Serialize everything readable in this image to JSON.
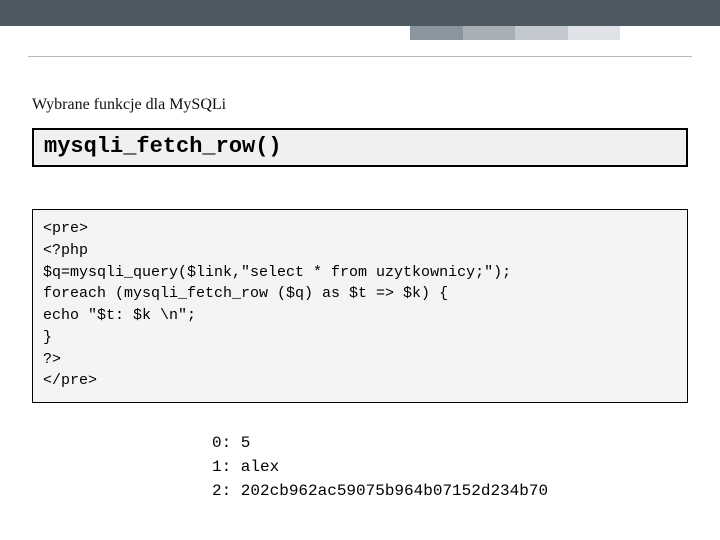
{
  "header": {
    "subtitle": "Wybrane funkcje dla MySQLi"
  },
  "function_box": {
    "name": "mysqli_fetch_row()"
  },
  "code": {
    "lines": [
      "<pre>",
      "<?php",
      "$q=mysqli_query($link,\"select * from uzytkownicy;\");",
      "foreach (mysqli_fetch_row ($q) as $t => $k) {",
      "echo \"$t: $k \\n\";",
      "}",
      "?>",
      "</pre>"
    ]
  },
  "output": {
    "lines": [
      "0: 5",
      "1: alex",
      "2: 202cb962ac59075b964b07152d234b70"
    ]
  }
}
